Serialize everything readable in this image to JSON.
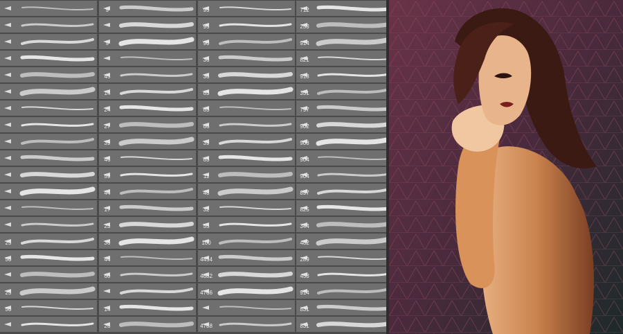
{
  "brush_panel": {
    "columns": [
      [
        "",
        "",
        "",
        "",
        "",
        "",
        "",
        "",
        "",
        "",
        "",
        "",
        "",
        "",
        "25",
        "50",
        "",
        "25",
        "50",
        ""
      ],
      [
        "9",
        "",
        "9",
        "",
        "45",
        "14",
        "24",
        "27",
        "39",
        "46",
        "59",
        "44",
        "17",
        "23",
        "36",
        "44",
        "60",
        "",
        "14",
        "26"
      ],
      [
        "95",
        "95",
        "90",
        "36",
        "36",
        "63",
        "63",
        "66",
        "39",
        "63",
        "11",
        "48",
        "32",
        "55",
        "100",
        "4454",
        "4682",
        "4766",
        "",
        "4788"
      ],
      [
        "712",
        "253",
        "914",
        "821",
        "918",
        "351",
        "797",
        "902",
        "908",
        "904",
        "904",
        "897",
        "825",
        "344",
        "482",
        "289",
        "453",
        "914",
        "831",
        "831"
      ]
    ]
  },
  "colors": {
    "panel_bg": "#4a4a4a",
    "cell_bg": "#6f6f6f",
    "stroke": "#f2f2f2",
    "skin": "#c9824d",
    "hair": "#3b1a14",
    "background_pattern": "#5c3040"
  },
  "icons": [
    "brush-tip-icon",
    "brush-preset-icon"
  ]
}
